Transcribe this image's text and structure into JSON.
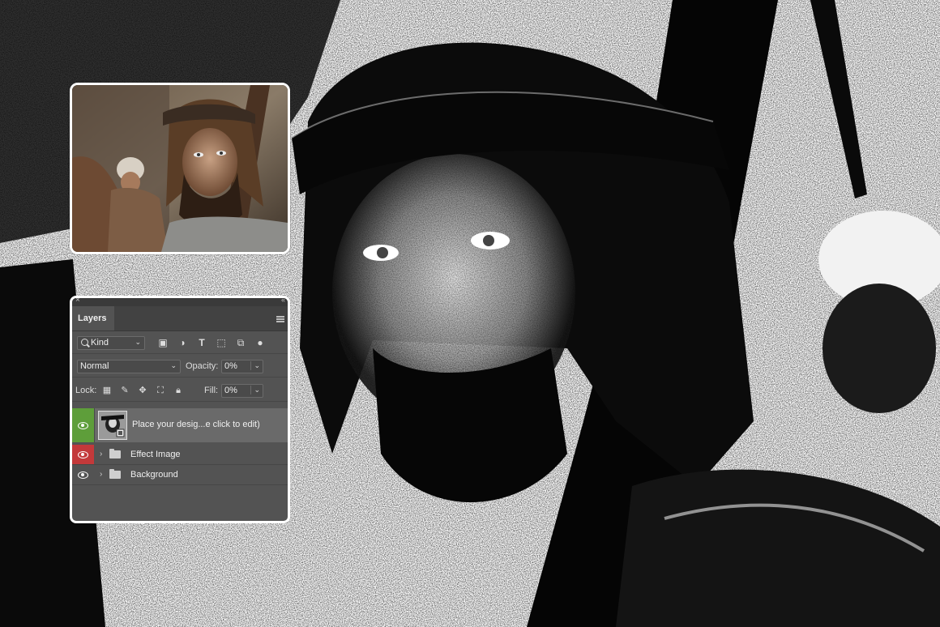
{
  "panel": {
    "tab_label": "Layers",
    "filter": {
      "kind_label": "Kind",
      "icons": [
        "image-filter-icon",
        "adjustment-filter-icon",
        "type-filter-icon",
        "shape-filter-icon",
        "smart-object-filter-icon",
        "toggle-filter-icon"
      ]
    },
    "blend_mode": "Normal",
    "opacity_label": "Opacity:",
    "opacity_value": "0%",
    "lock_label": "Lock:",
    "fill_label": "Fill:",
    "fill_value": "0%",
    "layers": [
      {
        "name": "Place your desig...e click to edit)",
        "type": "smart-object",
        "eye_color": "#5e9e3a"
      },
      {
        "name": "Effect Image",
        "type": "group",
        "eye_color": "#c3393a"
      },
      {
        "name": "Background",
        "type": "group",
        "eye_color": ""
      }
    ]
  },
  "colors": {
    "panel_bg": "#535353",
    "tab_bar": "#424242",
    "selected_row": "#6a6a6a"
  }
}
